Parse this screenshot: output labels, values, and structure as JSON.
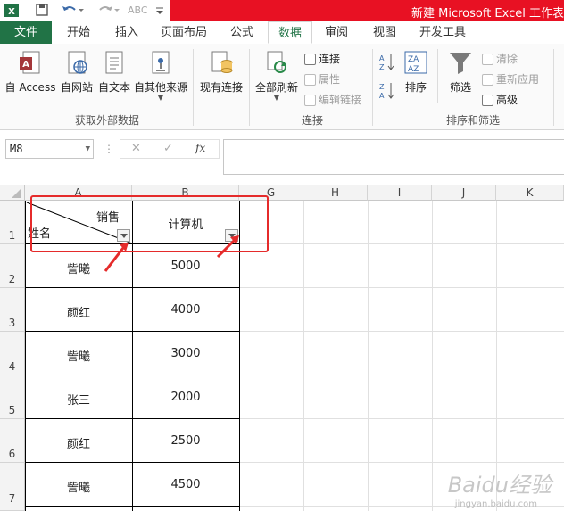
{
  "titlebar": {
    "title": "新建 Microsoft Excel 工作表",
    "app_icon": "excel-icon",
    "quick_access": [
      "save-icon",
      "undo-icon",
      "redo-icon",
      "spellcheck-icon",
      "customize-icon"
    ]
  },
  "tabs": [
    {
      "label": "文件"
    },
    {
      "label": "开始"
    },
    {
      "label": "插入"
    },
    {
      "label": "页面布局"
    },
    {
      "label": "公式"
    },
    {
      "label": "数据"
    },
    {
      "label": "审阅"
    },
    {
      "label": "视图"
    },
    {
      "label": "开发工具"
    }
  ],
  "ribbon": {
    "external": {
      "group_label": "获取外部数据",
      "access": "自 Access",
      "web": "自网站",
      "text": "自文本",
      "other": "自其他来源"
    },
    "existing_connections": "现有连接",
    "connections": {
      "group_label": "连接",
      "refresh_all": "全部刷新",
      "connections": "连接",
      "properties": "属性",
      "edit_links": "编辑链接"
    },
    "sort_filter": {
      "group_label": "排序和筛选",
      "sort": "排序",
      "filter": "筛选",
      "clear": "清除",
      "reapply": "重新应用",
      "advanced": "高级"
    }
  },
  "formula_bar": {
    "name_box": "M8",
    "fx": "fx",
    "value": ""
  },
  "sheet": {
    "columns": [
      "A",
      "B",
      "G",
      "H",
      "I",
      "J",
      "K"
    ],
    "rows": [
      "1",
      "2",
      "3",
      "4",
      "5",
      "6",
      "7"
    ],
    "header_top_right": "销售",
    "header_bottom_left": "姓名",
    "header_b": "计算机",
    "data": [
      {
        "name": "訾曦",
        "value": "5000"
      },
      {
        "name": "颜红",
        "value": "4000"
      },
      {
        "name": "訾曦",
        "value": "3000"
      },
      {
        "name": "张三",
        "value": "2000"
      },
      {
        "name": "颜红",
        "value": "2500"
      },
      {
        "name": "訾曦",
        "value": "4500"
      }
    ]
  },
  "watermark": {
    "logo": "Baidu经验",
    "sub": "jingyan.baidu.com"
  },
  "colors": {
    "excel_green": "#217346",
    "title_red": "#e81123",
    "highlight_red": "#e52b2b"
  }
}
